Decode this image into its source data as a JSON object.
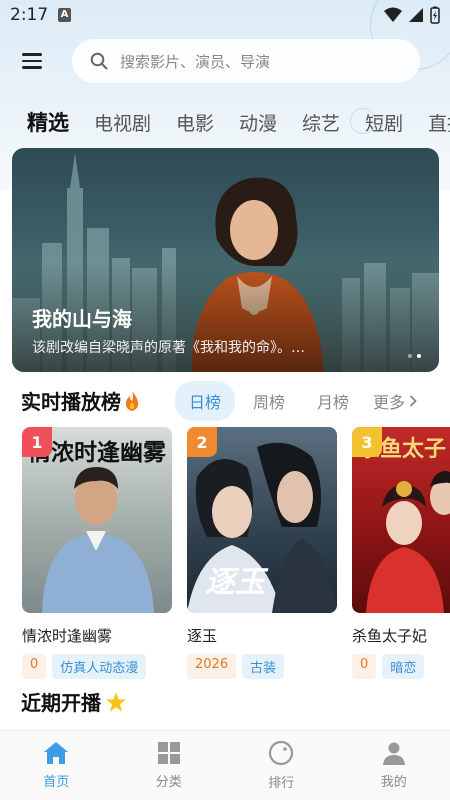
{
  "status": {
    "time": "2:17",
    "indicator": "A"
  },
  "search": {
    "placeholder": "搜索影片、演员、导演"
  },
  "categories": [
    {
      "label": "精选",
      "active": true
    },
    {
      "label": "电视剧"
    },
    {
      "label": "电影"
    },
    {
      "label": "动漫"
    },
    {
      "label": "综艺"
    },
    {
      "label": "短剧"
    },
    {
      "label": "直播"
    }
  ],
  "banner": {
    "title": "我的山与海",
    "desc": "该剧改编自梁晓声的原著《我和我的命》。…",
    "dots": 2,
    "active_dot": 1
  },
  "ranking": {
    "title": "实时播放榜",
    "title_icon": "fire-icon",
    "tabs": [
      {
        "label": "日榜",
        "active": true
      },
      {
        "label": "周榜"
      },
      {
        "label": "月榜"
      }
    ],
    "more": "更多"
  },
  "cards": [
    {
      "rank": "1",
      "badge_color": "#f0505a",
      "title": "情浓时逢幽雾",
      "poster_text": "情浓时逢幽雾",
      "tags": [
        {
          "text": "0",
          "style": "orange"
        },
        {
          "text": "仿真人动态漫",
          "style": "blue"
        }
      ]
    },
    {
      "rank": "2",
      "badge_color": "#f08a30",
      "title": "逐玉",
      "poster_text": "逐玉",
      "tags": [
        {
          "text": "2026",
          "style": "orange"
        },
        {
          "text": "古装",
          "style": "blue"
        }
      ]
    },
    {
      "rank": "3",
      "badge_color": "#f2c230",
      "title": "杀鱼太子妃",
      "poster_text": "杀鱼太子",
      "tags": [
        {
          "text": "0",
          "style": "orange"
        },
        {
          "text": "暗恋",
          "style": "blue"
        }
      ]
    }
  ],
  "upcoming": {
    "title": "近期开播",
    "title_icon": "star-icon"
  },
  "nav": [
    {
      "label": "首页",
      "icon": "home-icon",
      "active": true
    },
    {
      "label": "分类",
      "icon": "grid-icon"
    },
    {
      "label": "排行",
      "icon": "rank-icon"
    },
    {
      "label": "我的",
      "icon": "user-icon"
    }
  ],
  "colors": {
    "accent": "#3a9ee8",
    "tag_orange": "#e07a2a",
    "tag_blue": "#3a8fd6"
  }
}
